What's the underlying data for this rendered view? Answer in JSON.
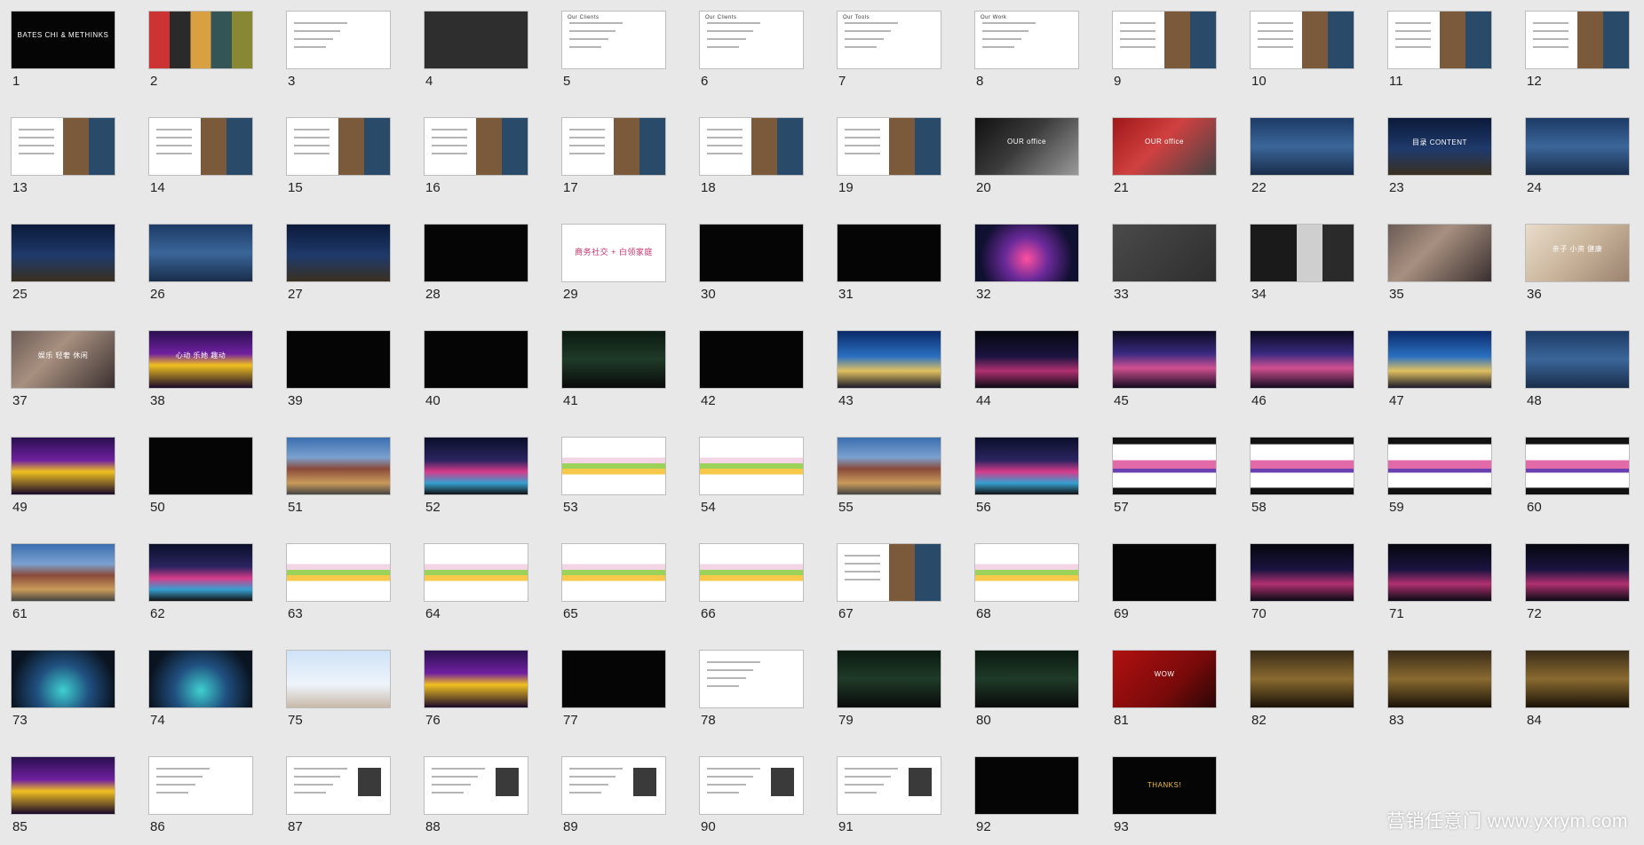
{
  "watermark": "营销任意门 www.yxrym.com",
  "slides": [
    {
      "n": "1",
      "style": "t-black",
      "text": "BATES CHI & METHINKS"
    },
    {
      "n": "2",
      "style": "t-collage",
      "text": ""
    },
    {
      "n": "3",
      "style": "t-white",
      "text": ""
    },
    {
      "n": "4",
      "style": "t-dark",
      "text": ""
    },
    {
      "n": "5",
      "style": "t-white",
      "text": "Our Clients"
    },
    {
      "n": "6",
      "style": "t-white",
      "text": "Our Clients"
    },
    {
      "n": "7",
      "style": "t-white",
      "text": "Our Tools"
    },
    {
      "n": "8",
      "style": "t-white",
      "text": "Our Work"
    },
    {
      "n": "9",
      "style": "t-mixed",
      "text": ""
    },
    {
      "n": "10",
      "style": "t-mixed",
      "text": ""
    },
    {
      "n": "11",
      "style": "t-mixed",
      "text": ""
    },
    {
      "n": "12",
      "style": "t-mixed",
      "text": ""
    },
    {
      "n": "13",
      "style": "t-mixed",
      "text": ""
    },
    {
      "n": "14",
      "style": "t-mixed",
      "text": ""
    },
    {
      "n": "15",
      "style": "t-mixed",
      "text": ""
    },
    {
      "n": "16",
      "style": "t-mixed",
      "text": ""
    },
    {
      "n": "17",
      "style": "t-mixed",
      "text": ""
    },
    {
      "n": "18",
      "style": "t-mixed",
      "text": ""
    },
    {
      "n": "19",
      "style": "t-mixed",
      "text": ""
    },
    {
      "n": "20",
      "style": "t-office",
      "text": "OUR office"
    },
    {
      "n": "21",
      "style": "t-office2",
      "text": "OUR office"
    },
    {
      "n": "22",
      "style": "t-city",
      "text": ""
    },
    {
      "n": "23",
      "style": "t-night",
      "text": "目录 CONTENT"
    },
    {
      "n": "24",
      "style": "t-city",
      "text": ""
    },
    {
      "n": "25",
      "style": "t-night",
      "text": ""
    },
    {
      "n": "26",
      "style": "t-city",
      "text": ""
    },
    {
      "n": "27",
      "style": "t-night",
      "text": ""
    },
    {
      "n": "28",
      "style": "t-black",
      "text": ""
    },
    {
      "n": "29",
      "style": "t-pink",
      "text": "商务社交 + 白领家庭"
    },
    {
      "n": "30",
      "style": "t-black",
      "text": ""
    },
    {
      "n": "31",
      "style": "t-black",
      "text": ""
    },
    {
      "n": "32",
      "style": "t-neon",
      "text": ""
    },
    {
      "n": "33",
      "style": "t-grey",
      "text": ""
    },
    {
      "n": "34",
      "style": "t-face",
      "text": ""
    },
    {
      "n": "35",
      "style": "t-photo",
      "text": ""
    },
    {
      "n": "36",
      "style": "t-baby",
      "text": "亲子 小资 健康"
    },
    {
      "n": "37",
      "style": "t-photo",
      "text": "娱乐 轻奢 休闲"
    },
    {
      "n": "38",
      "style": "t-stage",
      "text": "心动 乐她 趣动"
    },
    {
      "n": "39",
      "style": "t-black",
      "text": ""
    },
    {
      "n": "40",
      "style": "t-black",
      "text": ""
    },
    {
      "n": "41",
      "style": "t-green",
      "text": ""
    },
    {
      "n": "42",
      "style": "t-black",
      "text": ""
    },
    {
      "n": "43",
      "style": "t-blueplaza",
      "text": ""
    },
    {
      "n": "44",
      "style": "t-night2",
      "text": ""
    },
    {
      "n": "45",
      "style": "t-sky",
      "text": ""
    },
    {
      "n": "46",
      "style": "t-sky",
      "text": ""
    },
    {
      "n": "47",
      "style": "t-blueplaza",
      "text": ""
    },
    {
      "n": "48",
      "style": "t-city",
      "text": ""
    },
    {
      "n": "49",
      "style": "t-stage",
      "text": ""
    },
    {
      "n": "50",
      "style": "t-black",
      "text": ""
    },
    {
      "n": "51",
      "style": "t-build",
      "text": ""
    },
    {
      "n": "52",
      "style": "t-lightbuild",
      "text": ""
    },
    {
      "n": "53",
      "style": "t-wave",
      "text": ""
    },
    {
      "n": "54",
      "style": "t-wave",
      "text": ""
    },
    {
      "n": "55",
      "style": "t-build",
      "text": ""
    },
    {
      "n": "56",
      "style": "t-lightbuild",
      "text": ""
    },
    {
      "n": "57",
      "style": "t-wave2",
      "text": ""
    },
    {
      "n": "58",
      "style": "t-wave2",
      "text": ""
    },
    {
      "n": "59",
      "style": "t-wave2",
      "text": ""
    },
    {
      "n": "60",
      "style": "t-wave2",
      "text": ""
    },
    {
      "n": "61",
      "style": "t-build",
      "text": ""
    },
    {
      "n": "62",
      "style": "t-lightbuild",
      "text": ""
    },
    {
      "n": "63",
      "style": "t-wave",
      "text": ""
    },
    {
      "n": "64",
      "style": "t-wave",
      "text": ""
    },
    {
      "n": "65",
      "style": "t-wave",
      "text": ""
    },
    {
      "n": "66",
      "style": "t-wave",
      "text": ""
    },
    {
      "n": "67",
      "style": "t-mixed",
      "text": ""
    },
    {
      "n": "68",
      "style": "t-wave",
      "text": ""
    },
    {
      "n": "69",
      "style": "t-black",
      "text": ""
    },
    {
      "n": "70",
      "style": "t-night2",
      "text": ""
    },
    {
      "n": "71",
      "style": "t-night2",
      "text": ""
    },
    {
      "n": "72",
      "style": "t-night2",
      "text": ""
    },
    {
      "n": "73",
      "style": "t-teal",
      "text": ""
    },
    {
      "n": "74",
      "style": "t-teal",
      "text": ""
    },
    {
      "n": "75",
      "style": "t-arch",
      "text": ""
    },
    {
      "n": "76",
      "style": "t-stage",
      "text": ""
    },
    {
      "n": "77",
      "style": "t-black",
      "text": ""
    },
    {
      "n": "78",
      "style": "t-white",
      "text": ""
    },
    {
      "n": "79",
      "style": "t-green",
      "text": ""
    },
    {
      "n": "80",
      "style": "t-green",
      "text": ""
    },
    {
      "n": "81",
      "style": "t-red",
      "text": "WOW"
    },
    {
      "n": "82",
      "style": "t-gold",
      "text": ""
    },
    {
      "n": "83",
      "style": "t-gold",
      "text": ""
    },
    {
      "n": "84",
      "style": "t-gold",
      "text": ""
    },
    {
      "n": "85",
      "style": "t-stage",
      "text": ""
    },
    {
      "n": "86",
      "style": "t-white",
      "text": ""
    },
    {
      "n": "87",
      "style": "t-profile",
      "text": ""
    },
    {
      "n": "88",
      "style": "t-profile",
      "text": ""
    },
    {
      "n": "89",
      "style": "t-profile",
      "text": ""
    },
    {
      "n": "90",
      "style": "t-profile",
      "text": ""
    },
    {
      "n": "91",
      "style": "t-profile",
      "text": ""
    },
    {
      "n": "92",
      "style": "t-black",
      "text": ""
    },
    {
      "n": "93",
      "style": "t-black",
      "text": "THANKS!"
    }
  ]
}
